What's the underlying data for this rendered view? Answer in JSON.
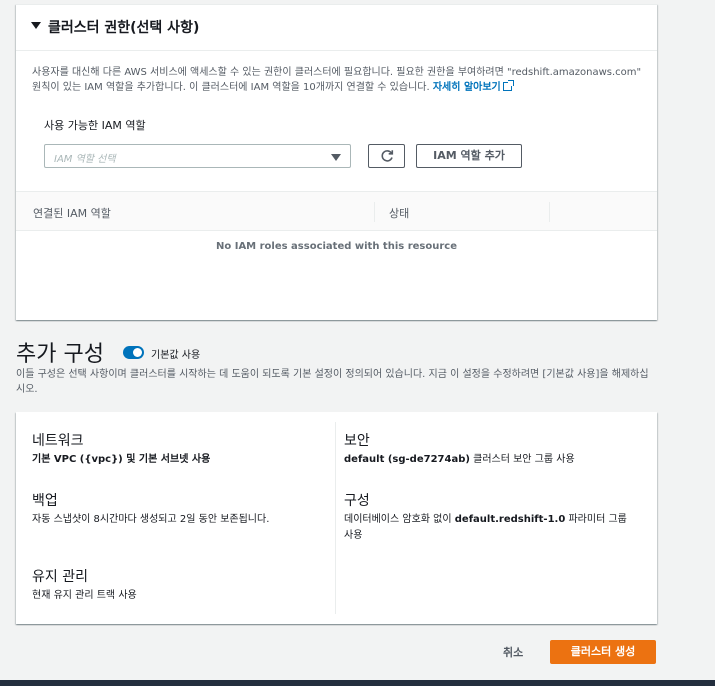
{
  "permissions": {
    "title": "클러스터 권한(선택 사항)",
    "description": "사용자를 대신해 다른 AWS 서비스에 액세스할 수 있는 권한이 클러스터에 필요합니다. 필요한 권한을 부여하려면 \"redshift.amazonaws.com\" 원칙이 있는 IAM 역할을 추가합니다. 이 클러스터에 IAM 역할을 10개까지 연결할 수 있습니다.",
    "learn_more": "자세히 알아보기",
    "available_label": "사용 가능한 IAM 역할",
    "select_placeholder": "IAM 역할 선택",
    "add_button": "IAM 역할 추가",
    "table": {
      "headers": [
        "연결된 IAM 역할",
        "상태"
      ],
      "empty_message": "No IAM roles associated with this resource"
    }
  },
  "additional": {
    "title": "추가 구성",
    "toggle_label": "기본값 사용",
    "toggle_on": true,
    "description": "이들 구성은 선택 사항이며 클러스터를 시작하는 데 도움이 되도록 기본 설정이 정의되어 있습니다. 지금 이 설정을 수정하려면 [기본값 사용]을 해제하십시오.",
    "network_title": "네트워크",
    "network_value": "기본 VPC ({vpc}) 및 기본 서브넷 사용",
    "security_title": "보안",
    "security_value_bold": "default (sg-de7274ab)",
    "security_value_rest": " 클러스터 보안 그룹 사용",
    "backup_title": "백업",
    "backup_value": "자동 스냅샷이 8시간마다 생성되고 2일 동안 보존됩니다.",
    "config_title": "구성",
    "config_value_a": "데이터베이스 암호화 없이 ",
    "config_value_bold": "default.redshift-1.0",
    "config_value_b": " 파라미터 그룹 사용",
    "maintenance_title": "유지 관리",
    "maintenance_value": "현재 유지 관리 트랙 사용"
  },
  "actions": {
    "cancel": "취소",
    "create": "클러스터 생성"
  },
  "colors": {
    "primary": "#ec7211",
    "link": "#0073bb",
    "toggle": "#0073bb"
  }
}
